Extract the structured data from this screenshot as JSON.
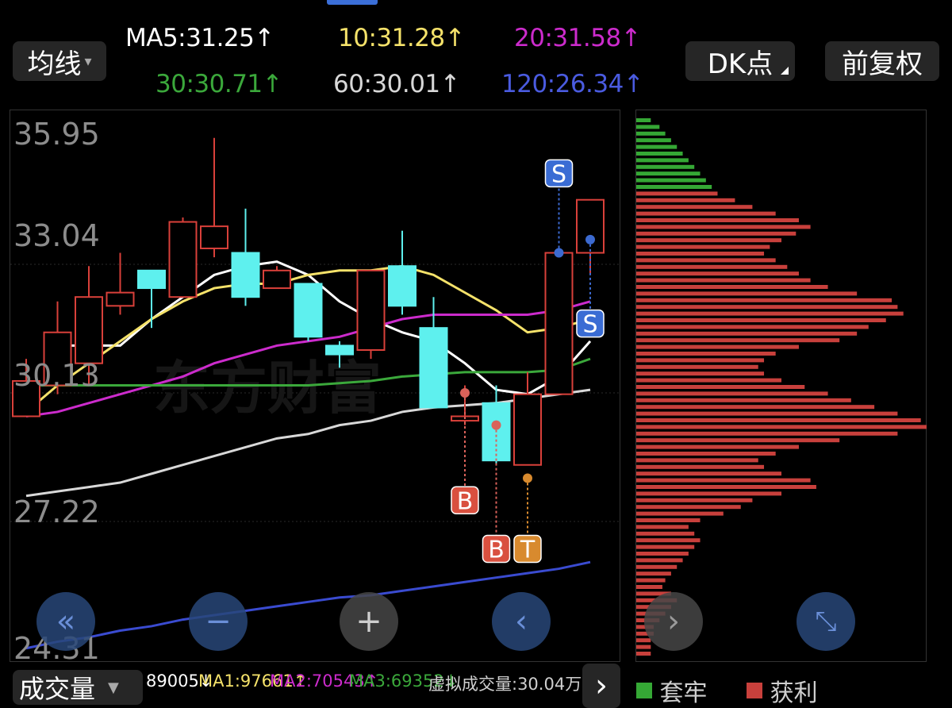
{
  "header": {
    "ma_selector": "均线",
    "ma5": "MA5:31.25",
    "ma10": "10:31.28",
    "ma20": "20:31.58",
    "ma30": "30:30.71",
    "ma60": "60:30.01",
    "ma120": "120:26.34",
    "arrow": "↑",
    "dk_button": "DK点",
    "adjust_button": "前复权"
  },
  "colors": {
    "up": "#d9403a",
    "down": "#5ef0ee",
    "ma5": "#ffffff",
    "ma10": "#f5e26a",
    "ma20": "#cc2bcc",
    "ma30": "#3ba83b",
    "ma60": "#d8d8d8",
    "ma120": "#3a4bd0",
    "profit": "#c8403c",
    "trapped": "#35a835"
  },
  "watermark": "东方财富",
  "chart_data": {
    "type": "candlestick",
    "ylim": [
      24.31,
      35.95
    ],
    "yticks": [
      "35.95",
      "33.04",
      "30.13",
      "27.22",
      "24.31"
    ],
    "candles": [
      {
        "o": 29.6,
        "c": 30.4,
        "h": 30.9,
        "l": 29.6
      },
      {
        "o": 30.3,
        "c": 31.5,
        "h": 32.2,
        "l": 30.1
      },
      {
        "o": 30.8,
        "c": 32.3,
        "h": 33.0,
        "l": 30.3
      },
      {
        "o": 32.1,
        "c": 32.4,
        "h": 33.3,
        "l": 31.9
      },
      {
        "o": 32.9,
        "c": 32.5,
        "h": 32.9,
        "l": 31.6
      },
      {
        "o": 32.3,
        "c": 34.0,
        "h": 34.1,
        "l": 32.3
      },
      {
        "o": 33.4,
        "c": 33.9,
        "h": 35.9,
        "l": 33.2
      },
      {
        "o": 33.3,
        "c": 32.3,
        "h": 34.3,
        "l": 32.1
      },
      {
        "o": 32.5,
        "c": 32.9,
        "h": 33.0,
        "l": 32.5
      },
      {
        "o": 32.6,
        "c": 31.4,
        "h": 32.6,
        "l": 31.3
      },
      {
        "o": 31.2,
        "c": 31.0,
        "h": 31.3,
        "l": 30.7
      },
      {
        "o": 31.1,
        "c": 32.9,
        "h": 32.9,
        "l": 30.9
      },
      {
        "o": 33.0,
        "c": 32.1,
        "h": 33.8,
        "l": 31.9
      },
      {
        "o": 31.6,
        "c": 29.8,
        "h": 32.3,
        "l": 29.8
      },
      {
        "o": 29.5,
        "c": 29.6,
        "h": 30.3,
        "l": 29.4
      },
      {
        "o": 29.9,
        "c": 28.6,
        "h": 30.3,
        "l": 28.5
      },
      {
        "o": 28.5,
        "c": 30.1,
        "h": 30.6,
        "l": 28.5
      },
      {
        "o": 30.1,
        "c": 33.3,
        "h": 33.3,
        "l": 30.1
      },
      {
        "o": 33.3,
        "c": 34.5,
        "h": 34.5,
        "l": 32.8
      }
    ],
    "ma": [
      {
        "name": "MA5",
        "values": [
          null,
          31.2,
          31.2,
          31.2,
          31.8,
          32.3,
          32.8,
          33.0,
          33.1,
          32.8,
          32.2,
          31.8,
          31.5,
          31.3,
          30.8,
          30.2,
          30.1,
          30.5,
          31.3
        ]
      },
      {
        "name": "MA10",
        "values": [
          29.7,
          30.3,
          30.8,
          31.3,
          31.8,
          32.2,
          32.5,
          32.6,
          32.6,
          32.8,
          32.9,
          32.9,
          33.0,
          32.8,
          32.4,
          32.0,
          31.5,
          31.6,
          31.8
        ]
      },
      {
        "name": "MA20",
        "values": [
          29.6,
          29.7,
          29.9,
          30.1,
          30.3,
          30.5,
          30.8,
          31.0,
          31.2,
          31.3,
          31.4,
          31.6,
          31.8,
          31.9,
          31.9,
          31.9,
          31.9,
          32.0,
          32.2
        ]
      },
      {
        "name": "MA30",
        "values": [
          30.3,
          30.3,
          30.3,
          30.3,
          30.3,
          30.3,
          30.3,
          30.3,
          30.3,
          30.3,
          30.35,
          30.4,
          30.5,
          30.55,
          30.6,
          30.6,
          30.6,
          30.65,
          30.9
        ]
      },
      {
        "name": "MA60",
        "values": [
          27.8,
          27.9,
          28.0,
          28.1,
          28.3,
          28.5,
          28.7,
          28.9,
          29.1,
          29.2,
          29.4,
          29.5,
          29.7,
          29.8,
          29.85,
          29.9,
          30.0,
          30.1,
          30.2
        ]
      },
      {
        "name": "MA120",
        "values": [
          24.35,
          24.5,
          24.6,
          24.75,
          24.85,
          25.0,
          25.1,
          25.2,
          25.3,
          25.4,
          25.5,
          25.55,
          25.65,
          25.75,
          25.85,
          25.95,
          26.05,
          26.15,
          26.3
        ]
      }
    ],
    "signals": [
      {
        "index": 14,
        "label": "B",
        "kind": "buy",
        "dot": 30.13,
        "badge": 27.7
      },
      {
        "index": 15,
        "label": "B",
        "kind": "buy",
        "dot": 29.4,
        "badge": 26.6
      },
      {
        "index": 16,
        "label": "T",
        "kind": "t",
        "dot": 28.2,
        "badge": 26.6
      },
      {
        "index": 17,
        "label": "S",
        "kind": "sell",
        "dot": 33.3,
        "badge": 35.1
      },
      {
        "index": 18,
        "label": "S",
        "kind": "sell",
        "dot": 33.6,
        "badge": 31.7
      }
    ],
    "chip_distribution": {
      "legend": [
        "套牢",
        "获利"
      ],
      "trapped_top": [
        0.05,
        0.08,
        0.1,
        0.12,
        0.14,
        0.16,
        0.18,
        0.2,
        0.22,
        0.24,
        0.26
      ],
      "profit": [
        0.28,
        0.34,
        0.4,
        0.48,
        0.56,
        0.6,
        0.55,
        0.5,
        0.46,
        0.44,
        0.48,
        0.52,
        0.56,
        0.6,
        0.66,
        0.76,
        0.88,
        0.9,
        0.92,
        0.86,
        0.8,
        0.76,
        0.7,
        0.56,
        0.48,
        0.44,
        0.42,
        0.44,
        0.5,
        0.58,
        0.66,
        0.74,
        0.82,
        0.9,
        0.98,
        1.0,
        0.9,
        0.7,
        0.56,
        0.48,
        0.42,
        0.44,
        0.5,
        0.6,
        0.62,
        0.5,
        0.4,
        0.36,
        0.3,
        0.22,
        0.18,
        0.2,
        0.22,
        0.2,
        0.18,
        0.16,
        0.14,
        0.12,
        0.1,
        0.09,
        0.12,
        0.14,
        0.12,
        0.1,
        0.08,
        0.06,
        0.06,
        0.05,
        0.05,
        0.05,
        0.05,
        0.04,
        0.04,
        0.04,
        0.04,
        0.04
      ]
    }
  },
  "volume_bar": {
    "label": "成交量",
    "value": "89005↓",
    "ma1": "MA1:97661↑",
    "ma2": "MA2:70543↑",
    "ma3": "MA3:69352↓",
    "virtual": "虚拟成交量:30.04万"
  },
  "nav_buttons": {
    "rewind": "«",
    "zoom_out": "−",
    "zoom_in": "+",
    "prev": "‹",
    "next": "›",
    "expand": "⤡",
    "panel_next": "›"
  }
}
